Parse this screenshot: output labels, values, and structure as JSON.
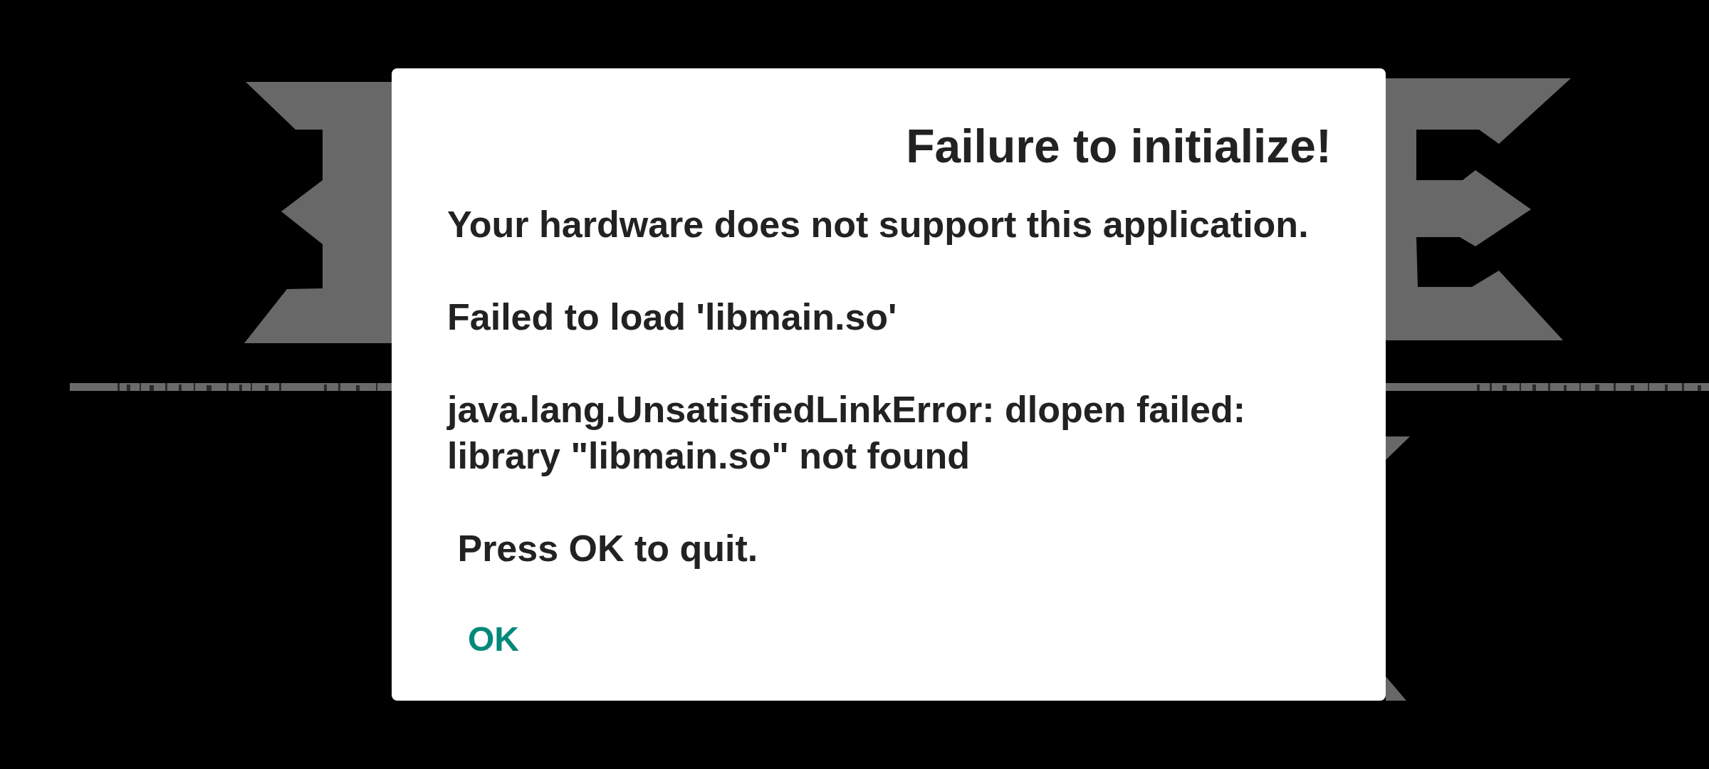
{
  "dialog": {
    "title": "Failure to initialize!",
    "message": [
      "Your hardware does not support this application.",
      "Failed to load 'libmain.so'",
      "java.lang.UnsatisfiedLinkError: dlopen failed: library \"libmain.so\" not found",
      " Press OK to quit."
    ],
    "buttons": [
      {
        "label": "OK"
      }
    ]
  }
}
